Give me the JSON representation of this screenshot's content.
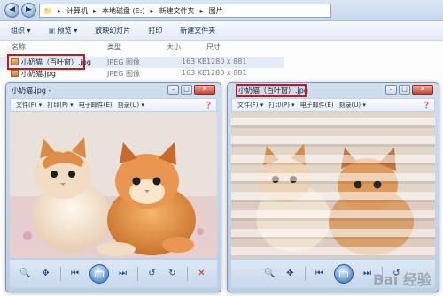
{
  "explorer": {
    "address": [
      "计算机",
      "本地磁盘 (E:)",
      "新建文件夹",
      "图片"
    ],
    "toolbar": {
      "organize": "组织",
      "preview": "预览",
      "slideshow": "放映幻灯片",
      "print": "打印",
      "new_folder": "新建文件夹"
    },
    "columns": {
      "name": "名称",
      "type": "类型",
      "size": "大小",
      "dims": "尺寸"
    },
    "files": [
      {
        "name": "小奶猫（百叶窗）.jpg",
        "type": "JPEG 图像",
        "size": "163 KB",
        "dims": "1280 x 881"
      },
      {
        "name": "小奶猫.jpg",
        "type": "JPEG 图像",
        "size": "163 KB",
        "dims": "1280 x 881"
      }
    ]
  },
  "viewer_left": {
    "title": "小奶猫.jpg -",
    "menu": [
      "文件(F)",
      "打印(P)",
      "电子邮件(E)",
      "刻录(U)"
    ]
  },
  "viewer_right": {
    "title": "小奶猫（百叶窗）.jpg",
    "menu": [
      "文件(F)",
      "打印(P)",
      "电子邮件(E)",
      "刻录(U)"
    ]
  },
  "watermark": "Bai 经验",
  "colors": {
    "highlight": "#d2121a",
    "accent": "#2a64ad"
  }
}
